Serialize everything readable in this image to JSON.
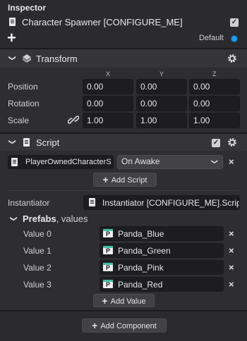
{
  "inspector": {
    "title": "Inspector",
    "object_name": "Character Spawner [CONFIGURE_ME]",
    "layer_label": "Default",
    "colors": {
      "accent": "#1e9cf0",
      "prefab_teal": "#3fbfaa"
    }
  },
  "transform": {
    "title": "Transform",
    "axes": [
      "X",
      "Y",
      "Z"
    ],
    "rows": [
      {
        "label": "Position",
        "values": [
          "0.00",
          "0.00",
          "0.00"
        ]
      },
      {
        "label": "Rotation",
        "values": [
          "0.00",
          "0.00",
          "0.00"
        ]
      },
      {
        "label": "Scale",
        "values": [
          "1.00",
          "1.00",
          "1.00"
        ]
      }
    ]
  },
  "script_component": {
    "title": "Script",
    "script_name": "PlayerOwnedCharacterS",
    "event": "On Awake",
    "add_script_label": "Add Script",
    "instantiator_label": "Instantiator",
    "instantiator_value": "Instantiator [CONFIGURE_ME].Script",
    "prefabs_label": "Prefabs",
    "prefabs_suffix": ", values",
    "prefabs": [
      {
        "label": "Value 0",
        "value": "Panda_Blue"
      },
      {
        "label": "Value 1",
        "value": "Panda_Green"
      },
      {
        "label": "Value 2",
        "value": "Panda_Pink"
      },
      {
        "label": "Value 3",
        "value": "Panda_Red"
      }
    ],
    "add_value_label": "Add Value"
  },
  "add_component_label": "Add Component",
  "icons": {
    "close": "×",
    "chevron": "❯",
    "check": "✓",
    "plus": "+"
  }
}
